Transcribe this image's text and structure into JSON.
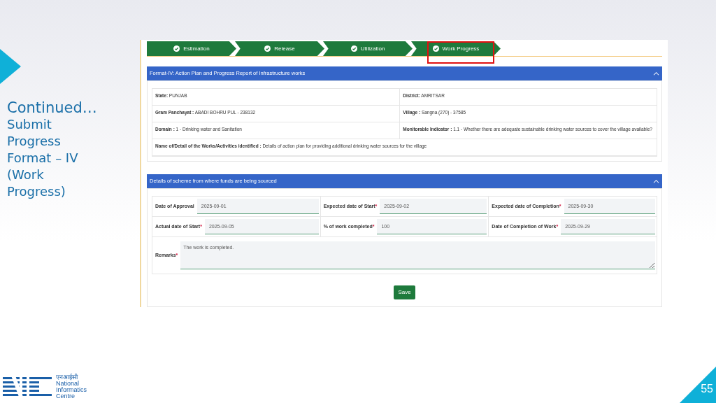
{
  "slide": {
    "heading": "Continued…",
    "subheading_lines": [
      "Submit",
      "Progress",
      "Format – IV",
      "(Work",
      "Progress)"
    ],
    "page_number": "55"
  },
  "logo": {
    "hindi": "एनआईसी",
    "name_lines": [
      "National",
      "Informatics",
      "Centre"
    ]
  },
  "steps": [
    {
      "label": "Estimation",
      "done": true,
      "selected": false
    },
    {
      "label": "Release",
      "done": true,
      "selected": false
    },
    {
      "label": "Utilization",
      "done": true,
      "selected": false
    },
    {
      "label": "Work Progress",
      "done": true,
      "selected": true
    }
  ],
  "info_panel": {
    "title": "Format-IV: Action Plan and Progress Report of Infrastructure works",
    "expanded": true,
    "rows": [
      [
        {
          "label": "State:",
          "value": "PUNJAB"
        },
        {
          "label": "District:",
          "value": "AMRITSAR"
        }
      ],
      [
        {
          "label": "Gram Panchayat :",
          "value": "ABADI BOHRU PUL - 238132"
        },
        {
          "label": "Village :",
          "value": "Sangna (270) - 37585"
        }
      ],
      [
        {
          "label": "Domain :",
          "value": "1 - Drinking water and Sanitation"
        },
        {
          "label": "Monitorable Indicator :",
          "value": "1.1 - Whether there are adequate sustainable drinking water sources to cover the village available?"
        }
      ],
      [
        {
          "label": "Name of/Detail of the Works/Activities identified :",
          "value": "Details of action plan for providing additional drinking water sources for the village"
        }
      ]
    ]
  },
  "scheme_panel": {
    "title": "Details of scheme from where funds are being sourced",
    "expanded": true,
    "fields": [
      {
        "kind": "input",
        "label": "Date of Approval",
        "required": false,
        "value": "2025-09-01"
      },
      {
        "kind": "input",
        "label": "Expected date of Start",
        "required": true,
        "value": "2025-09-02"
      },
      {
        "kind": "input",
        "label": "Expected date of Completion",
        "required": true,
        "value": "2025-09-30"
      },
      {
        "kind": "input",
        "label": "Actual date of Start",
        "required": true,
        "value": "2025-09-05"
      },
      {
        "kind": "input",
        "label": "% of work completed",
        "required": true,
        "value": "100"
      },
      {
        "kind": "input",
        "label": "Date of Completion of Work",
        "required": true,
        "value": "2025-09-29"
      },
      {
        "kind": "textarea",
        "label": "Remarks",
        "required": true,
        "value": "The work is completed."
      }
    ],
    "required_mark": "*",
    "button": "Save"
  }
}
